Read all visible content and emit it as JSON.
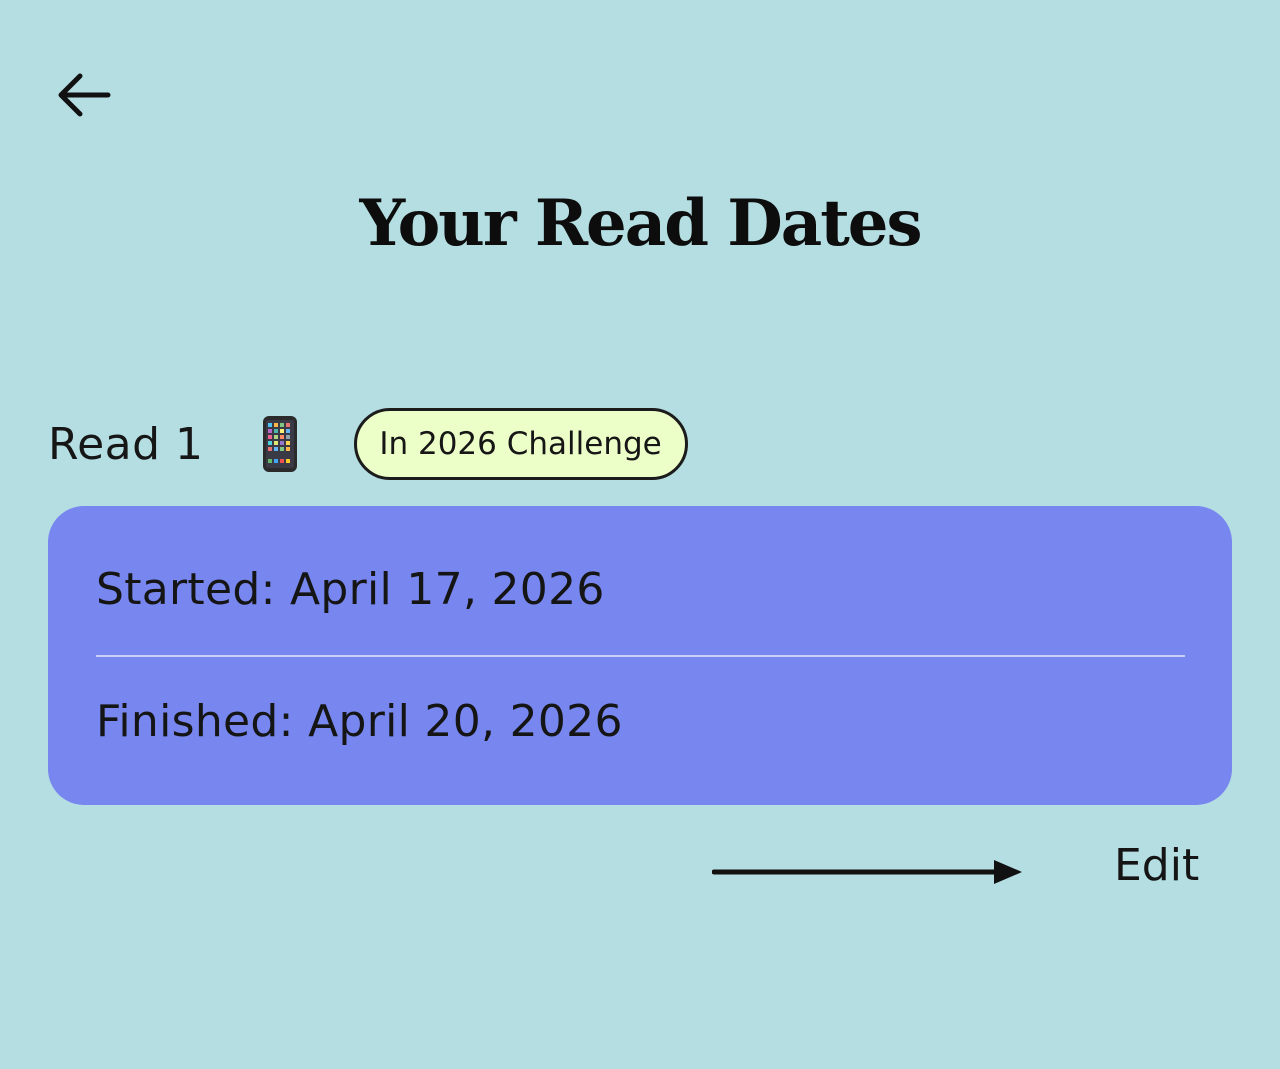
{
  "header": {
    "back_icon": "arrow-left-icon",
    "title": "Your Read Dates"
  },
  "read": {
    "label": "Read 1",
    "format_icon": "mobile-phone-icon",
    "challenge_badge": "In 2026 Challenge"
  },
  "dates": {
    "started": "Started: April 17, 2026",
    "finished": "Finished: April 20, 2026"
  },
  "actions": {
    "pointer_icon": "long-arrow-right-icon",
    "edit_label": "Edit"
  },
  "colors": {
    "background": "#b4dee2",
    "card": "#7887ef",
    "badge": "#ecffc8"
  }
}
